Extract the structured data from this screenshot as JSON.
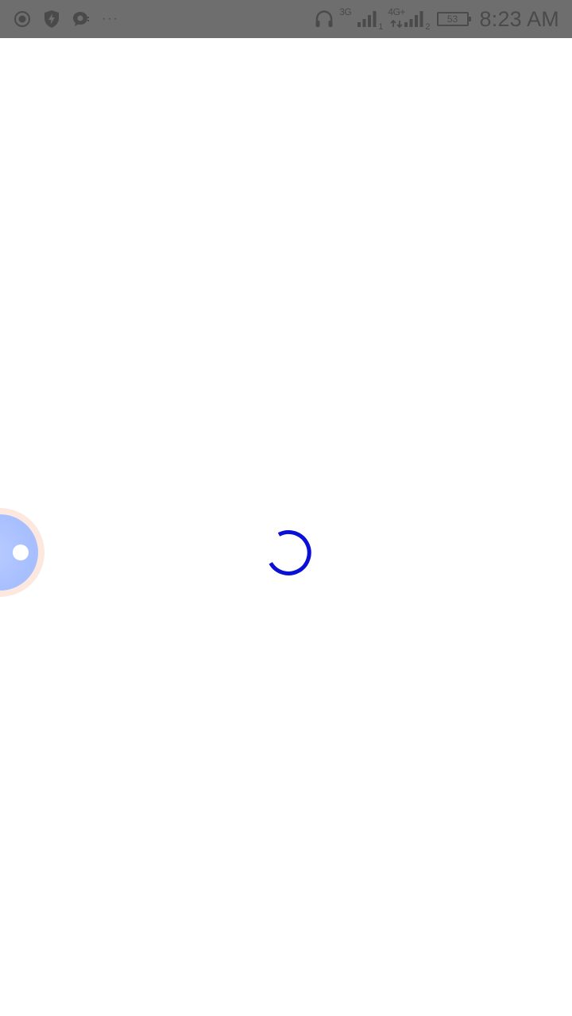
{
  "status_bar": {
    "left_icons": [
      "record-icon",
      "shield-bolt-icon",
      "chat-bubble-icon"
    ],
    "overflow": "···",
    "network_1": "3G",
    "sim_1": "1",
    "network_2": "4G+",
    "sim_2": "2",
    "battery_level": "53",
    "time": "8:23 AM"
  },
  "main": {
    "loading": true,
    "spinner_color": "#0a10d6"
  },
  "floating_button": {
    "icon": "assistive-touch-icon",
    "outer_color": "#fde8df",
    "inner_color": "#a9c0ff"
  },
  "colors": {
    "status_bar_bg": "#6e6e6e",
    "status_icon": "#4a4a4a",
    "background": "#ffffff"
  }
}
